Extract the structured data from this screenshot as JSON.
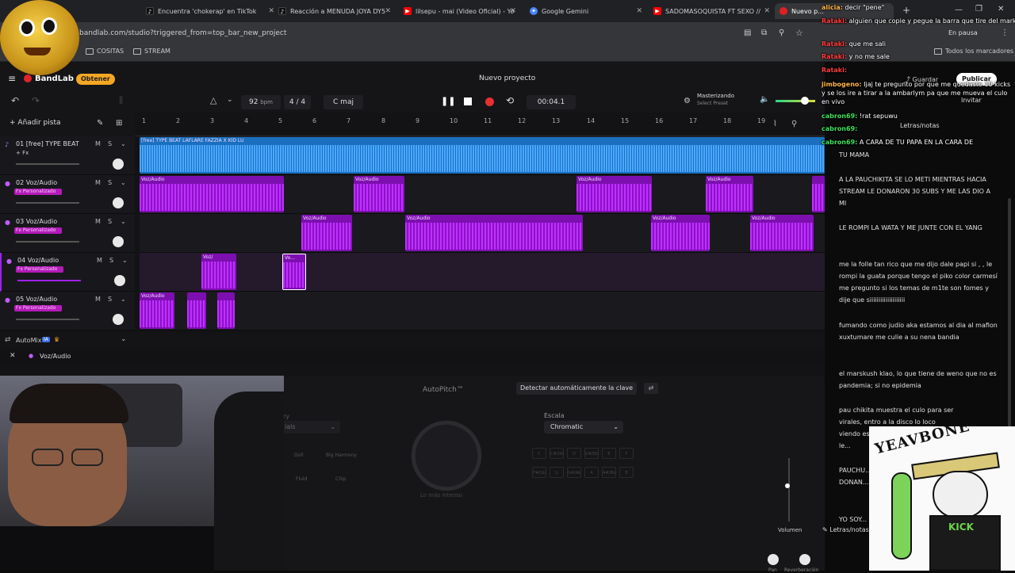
{
  "browser": {
    "tabs": [
      {
        "title": "Encuentra 'chokerap' en TikTok",
        "icon": "tiktok-icon"
      },
      {
        "title": "Reacción a MENUDA JOYA DY5",
        "icon": "tiktok-icon"
      },
      {
        "title": "lilsepu - mai (Video Oficial) - Yo",
        "icon": "youtube-icon"
      },
      {
        "title": "Google Gemini",
        "icon": "gemini-icon"
      },
      {
        "title": "SADOMASOQUISTA FT SEXO //",
        "icon": "youtube-icon"
      },
      {
        "title": "Nuevo p...",
        "icon": "bandlab-icon"
      }
    ],
    "url": "bandlab.com/studio?triggered_from=top_bar_new_project",
    "bookmarks": [
      "COSITAS",
      "STREAM"
    ],
    "all_bookmarks": "Todos los marcadores",
    "paused": "En pausa"
  },
  "app": {
    "logo": "BandLab",
    "upgrade": "Obtener",
    "project_title": "Nuevo proyecto",
    "save": "Guardar",
    "publish": "Publicar",
    "invite": "Invitar",
    "bpm_value": "92",
    "bpm_unit": "bpm",
    "time_signature": "4 / 4",
    "key": "C maj",
    "time": "00:04.1",
    "mastering": "Masterizando",
    "select_preset": "Select Preset",
    "add_track": "Añadir pista",
    "lyrics_tab": "Letras/notas",
    "ruler": [
      "1",
      "2",
      "3",
      "4",
      "5",
      "6",
      "7",
      "8",
      "9",
      "10",
      "11",
      "12",
      "13",
      "14",
      "15",
      "16",
      "17",
      "18",
      "19"
    ]
  },
  "tracks": [
    {
      "num": "01",
      "name": "[free] TYPE BEAT L...",
      "fx": "+ Fx",
      "type": "beat"
    },
    {
      "num": "02",
      "name": "Voz/Audio",
      "fx": "Fx Personalizado",
      "type": "voice"
    },
    {
      "num": "03",
      "name": "Voz/Audio",
      "fx": "Fx Personalizado",
      "type": "voice"
    },
    {
      "num": "04",
      "name": "Voz/Audio",
      "fx": "Fx Personalizado",
      "type": "voice"
    },
    {
      "num": "05",
      "name": "Voz/Audio",
      "fx": "Fx Personalizado",
      "type": "voice"
    }
  ],
  "clips": {
    "beat_label": "[free] TYPE BEAT LAFLARE FAZZIA X KID LU",
    "voice_label": "Voz/Audio",
    "voice_label_short": "Voz/",
    "voice_label_tiny": "Vo..."
  },
  "automix": {
    "label": "AutoMix",
    "badge": "IA"
  },
  "selected_track": "Voz/Audio",
  "panel": {
    "title": "AutoPitch™",
    "detect_key": "Detectar automáticamente la clave",
    "scale_label": "Escala",
    "scale_value": "Chromatic",
    "knob_label": "Lo más intenso",
    "volume": "Volumen",
    "pan": "Pan",
    "reverb": "Reverberación",
    "cat_left": "ry",
    "preset_left": "ials",
    "effects": [
      "Doll",
      "Big Harmony",
      "Fluid",
      "Chip"
    ],
    "notes": [
      "C",
      "C#/Db",
      "D",
      "D#/Eb",
      "E",
      "F",
      "F#/Gb",
      "G",
      "G#/Ab",
      "A",
      "A#/Bb",
      "B"
    ]
  },
  "chat": [
    {
      "user": "alicia:",
      "text": "decir \"pene\""
    },
    {
      "user": "Rataki:",
      "text": "alguien que copie y pegue la barra que tire del markush"
    },
    {
      "user": "Rataki:",
      "text": "que me sali"
    },
    {
      "user": "Rataki:",
      "text": "y no me sale"
    },
    {
      "user": "Rataki:",
      "text": ""
    },
    {
      "user": "jimbogeno:",
      "text": "Ijaj te pregunto por que me quedaste 10 kicks y se los ire a tirar a la ambarlym pa que me mueva el culo en vivo"
    },
    {
      "user": "cabron69:",
      "text": "!rat sepuwu"
    },
    {
      "user": "cabron69:",
      "text": ""
    },
    {
      "user": "cabron69:",
      "text": "A CARA DE TU PAPA EN LA CARA DE"
    }
  ],
  "lyrics": [
    "TU MAMA",
    "A LA PAUCHIKITA SE LO METI MIENTRAS HACIA STREAM LE DONARON 30 SUBS Y ME LAS DIO A MI",
    "LE ROMPI LA WATA Y ME JUNTE CON EL YANG",
    "me la folle tan rico que me dijo dale papi si , , le rompi la guata porque tengo el piko color carmesí  me pregunto si los temas de m1te son fomes y dije que siiiiiiiiiiiiiiiiiiii",
    "fumando como judio aka estamos al dia al mafion xuxtumare me culie a su nena bandia",
    "el marskush klao, lo que tiene de weno que no es pandemia; si no epidemia",
    "pau chikita muestra el culo para ser virales, entro a la disco lo loco viendo espirales, ella se ex... pico y le...",
    "PAUCHU... DONAN...",
    "YO SOY..."
  ],
  "sticker": {
    "text": "YEAVBONE",
    "text2": "KICK"
  }
}
